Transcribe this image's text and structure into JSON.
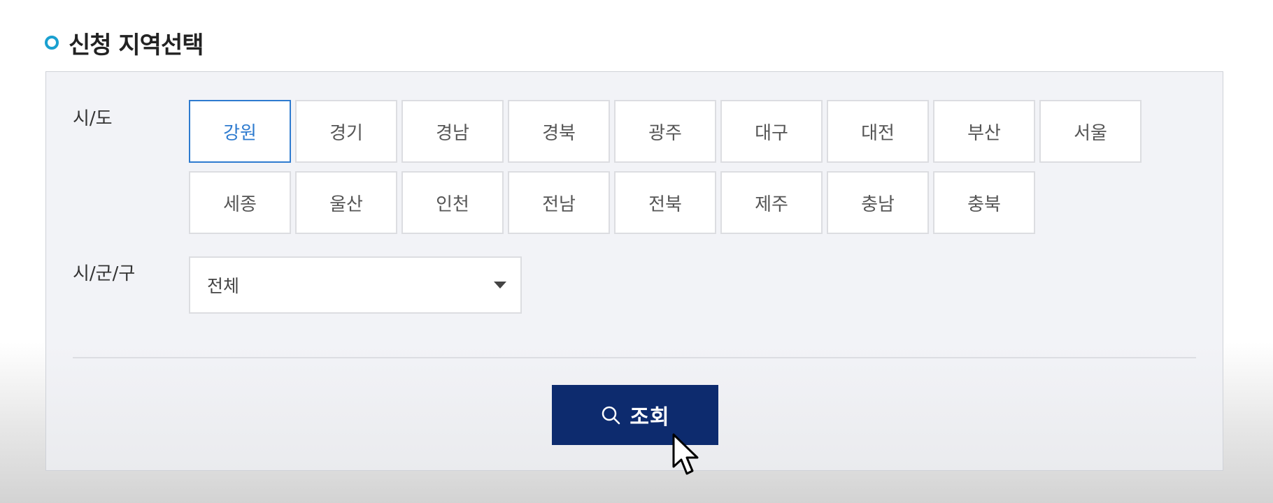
{
  "section": {
    "title": "신청 지역선택"
  },
  "sido": {
    "label": "시/도",
    "selected": "강원",
    "regions": [
      {
        "label": "강원",
        "selected": true
      },
      {
        "label": "경기"
      },
      {
        "label": "경남"
      },
      {
        "label": "경북"
      },
      {
        "label": "광주"
      },
      {
        "label": "대구"
      },
      {
        "label": "대전"
      },
      {
        "label": "부산"
      },
      {
        "label": "서울"
      },
      {
        "label": "세종"
      },
      {
        "label": "울산"
      },
      {
        "label": "인천"
      },
      {
        "label": "전남"
      },
      {
        "label": "전북"
      },
      {
        "label": "제주"
      },
      {
        "label": "충남"
      },
      {
        "label": "충북"
      }
    ]
  },
  "sigungu": {
    "label": "시/군/구",
    "value": "전체"
  },
  "search": {
    "label": "조회",
    "icon": "search-icon"
  },
  "colors": {
    "accent": "#2e7bcf",
    "button": "#0d2b6e",
    "title_dot": "#1aa0d0",
    "panel_bg": "#f2f3f7"
  }
}
